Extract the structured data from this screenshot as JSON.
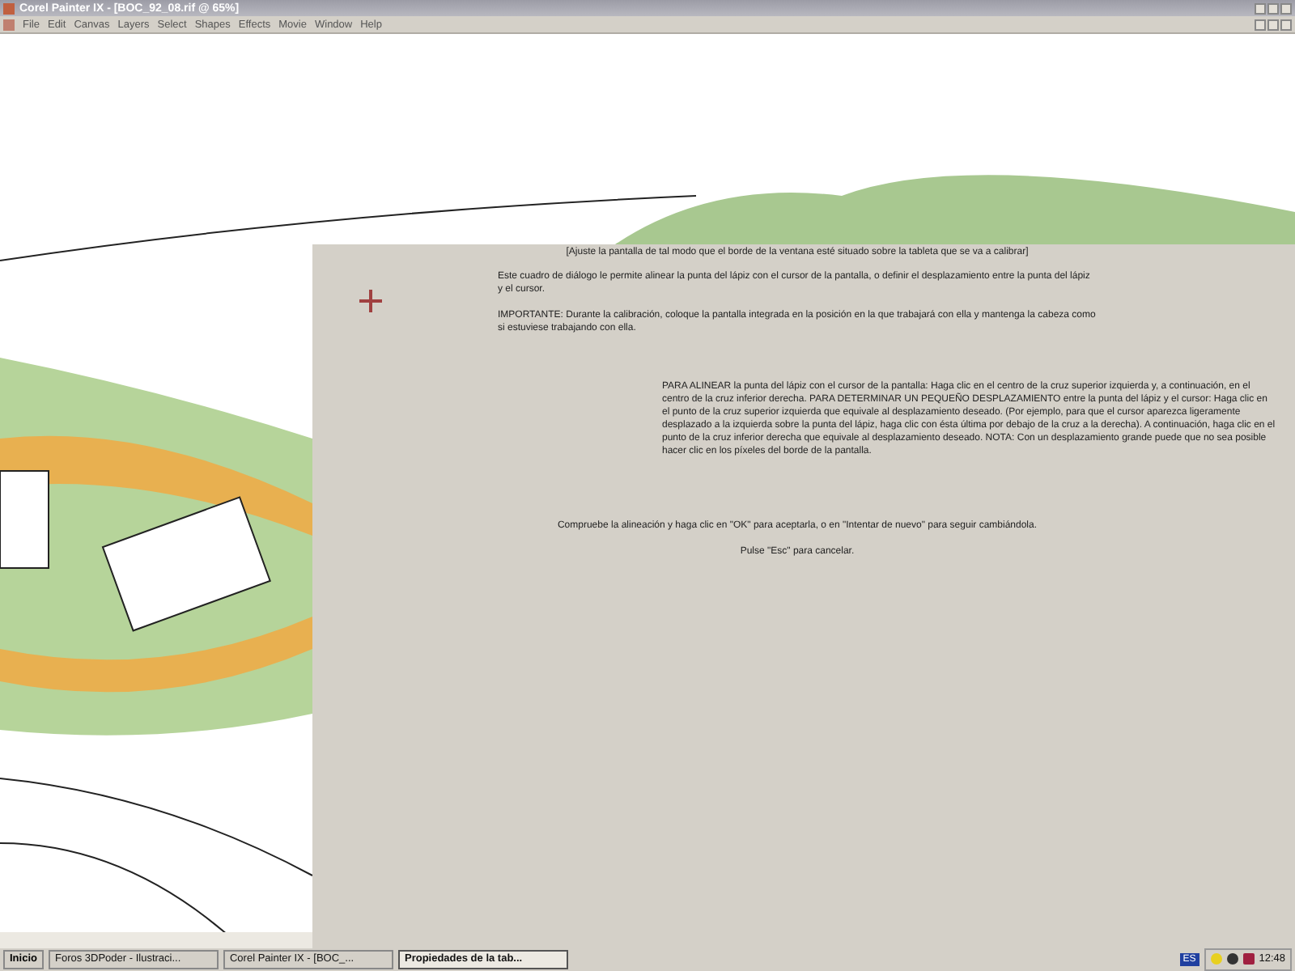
{
  "window": {
    "title": "Corel Painter IX - [BOC_92_08.rif @ 65%]"
  },
  "menu": [
    "File",
    "Edit",
    "Canvas",
    "Layers",
    "Select",
    "Shapes",
    "Effects",
    "Movie",
    "Window",
    "Help"
  ],
  "dialog": {
    "heading": "[Ajuste la pantalla de tal modo que el borde de la ventana esté situado sobre la tableta que se va a calibrar]",
    "intro": [
      "Este cuadro de diálogo le permite alinear la punta del lápiz con el cursor de la pantalla, o definir el desplazamiento entre la punta del lápiz y el cursor.",
      "IMPORTANTE: Durante la calibración, coloque la pantalla integrada en la posición en la que trabajará con ella y mantenga la cabeza como si estuviese trabajando con ella."
    ],
    "instructions": "PARA ALINEAR la punta del lápiz con el cursor de la pantalla: Haga clic en el centro de la cruz superior izquierda y, a continuación, en el centro de la cruz inferior derecha. PARA DETERMINAR UN PEQUEÑO DESPLAZAMIENTO entre la punta del lápiz y el cursor: Haga clic en el punto de la cruz superior izquierda que equivale al desplazamiento deseado. (Por ejemplo, para que el cursor aparezca ligeramente desplazado a la izquierda sobre la punta del lápiz, haga clic con ésta última por debajo de la cruz a la derecha). A continuación, haga clic en el punto de la cruz inferior derecha que equivale al desplazamiento deseado. NOTA: Con un desplazamiento grande puede que no sea posible hacer clic en los píxeles del borde de la pantalla.",
    "confirm": "Compruebe la alineación y haga clic en \"OK\" para aceptarla, o en \"Intentar de nuevo\" para seguir cambiándola.",
    "cancel": "Pulse \"Esc\" para cancelar."
  },
  "taskbar": {
    "start": "Inicio",
    "tasks": [
      {
        "label": "Foros 3DPoder - Ilustraci...",
        "selected": false
      },
      {
        "label": "Corel Painter IX - [BOC_...",
        "selected": false
      },
      {
        "label": "Propiedades de la tab...",
        "selected": true
      }
    ],
    "language": "ES",
    "clock": "12:48"
  }
}
